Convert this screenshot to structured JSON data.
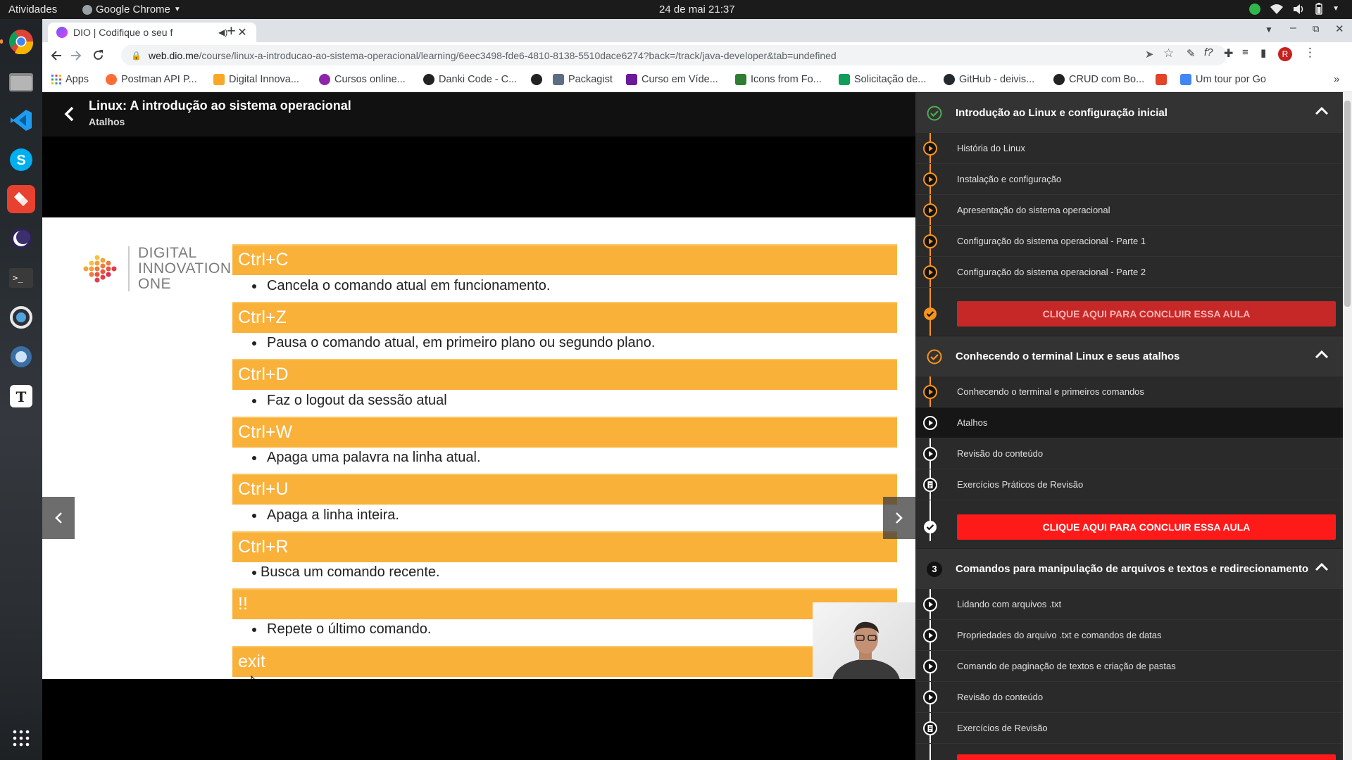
{
  "system": {
    "activities": "Atividades",
    "app_name": "Google Chrome",
    "clock": "24 de mai  21:37"
  },
  "browser": {
    "tab_title": "DIO | Codifique o seu f",
    "url_host": "web.dio.me",
    "url_path": "/course/linux-a-introducao-ao-sistema-operacional/learning/6eec3498-fde6-4810-8138-5510dace6274?back=/track/java-developer&tab=undefined",
    "profile_initial": "R",
    "bookmarks": [
      {
        "label": "Apps",
        "color": "#4285f4"
      },
      {
        "label": "Postman API P...",
        "color": "#ff6c37"
      },
      {
        "label": "Digital Innova...",
        "color": "#f9a825"
      },
      {
        "label": "Cursos online...",
        "color": "#8e24aa"
      },
      {
        "label": "Danki Code - C...",
        "color": "#222222"
      },
      {
        "label": "",
        "color": "#222222"
      },
      {
        "label": "Packagist",
        "color": "#5e6c84"
      },
      {
        "label": "Curso em Víde...",
        "color": "#6a1b9a"
      },
      {
        "label": "Icons from Fo...",
        "color": "#2e7d32"
      },
      {
        "label": "Solicitação de...",
        "color": "#0f9d58"
      },
      {
        "label": "GitHub - deivis...",
        "color": "#24292e"
      },
      {
        "label": "CRUD com Bo...",
        "color": "#222222"
      },
      {
        "label": "",
        "color": "#e24329"
      },
      {
        "label": "Um tour por Go",
        "color": "#4285f4"
      }
    ]
  },
  "course": {
    "title": "Linux: A introdução ao sistema operacional",
    "current_lesson": "Atalhos"
  },
  "slide": {
    "logo_lines": [
      "DIGITAL",
      "INNOVATION",
      "ONE"
    ],
    "shortcuts": [
      {
        "key": "Ctrl+C",
        "desc": "Cancela o comando atual em funcionamento."
      },
      {
        "key": "Ctrl+Z",
        "desc": "Pausa o comando atual, em primeiro plano ou  segundo plano."
      },
      {
        "key": "Ctrl+D",
        "desc": "Faz o logout da sessão atual"
      },
      {
        "key": "Ctrl+W",
        "desc": "Apaga uma palavra na linha atual."
      },
      {
        "key": "Ctrl+U",
        "desc": "Apaga a linha inteira."
      },
      {
        "key": "Ctrl+R",
        "desc": "Busca um comando recente."
      },
      {
        "key": "!!",
        "desc": "Repete o último comando."
      },
      {
        "key": "exit",
        "desc": ""
      }
    ]
  },
  "sidebar": {
    "modules": [
      {
        "number": "",
        "title": "Introdução ao Linux e configuração inicial",
        "status": "complete",
        "lessons": [
          "História do Linux",
          "Instalação e configuração",
          "Apresentação do sistema operacional",
          "Configuração do sistema operacional - Parte 1",
          "Configuração do sistema operacional - Parte 2"
        ],
        "conclude_label": "CLIQUE AQUI PARA CONCLUIR ESSA AULA"
      },
      {
        "number": "",
        "title": "Conhecendo o terminal Linux e seus atalhos",
        "status": "in-progress",
        "lessons": [
          "Conhecendo o terminal e primeiros comandos",
          "Atalhos",
          "Revisão do conteúdo",
          "Exercícios Práticos de Revisão"
        ],
        "conclude_label": "CLIQUE AQUI PARA CONCLUIR ESSA AULA"
      },
      {
        "number": "3",
        "title": "Comandos para manipulação de arquivos e textos e redirecionamento",
        "status": "pending",
        "lessons": [
          "Lidando com arquivos .txt",
          "Propriedades do arquivo .txt e comandos de datas",
          "Comando de paginação de textos e criação de pastas",
          "Revisão do conteúdo",
          "Exercícios de Revisão"
        ]
      }
    ]
  },
  "colors": {
    "accent_orange": "#f7941d",
    "key_bar": "#f9b13a",
    "conclude_dim": "#c62828",
    "conclude_bright": "#ff1a1a",
    "complete_green": "#4caf50"
  }
}
